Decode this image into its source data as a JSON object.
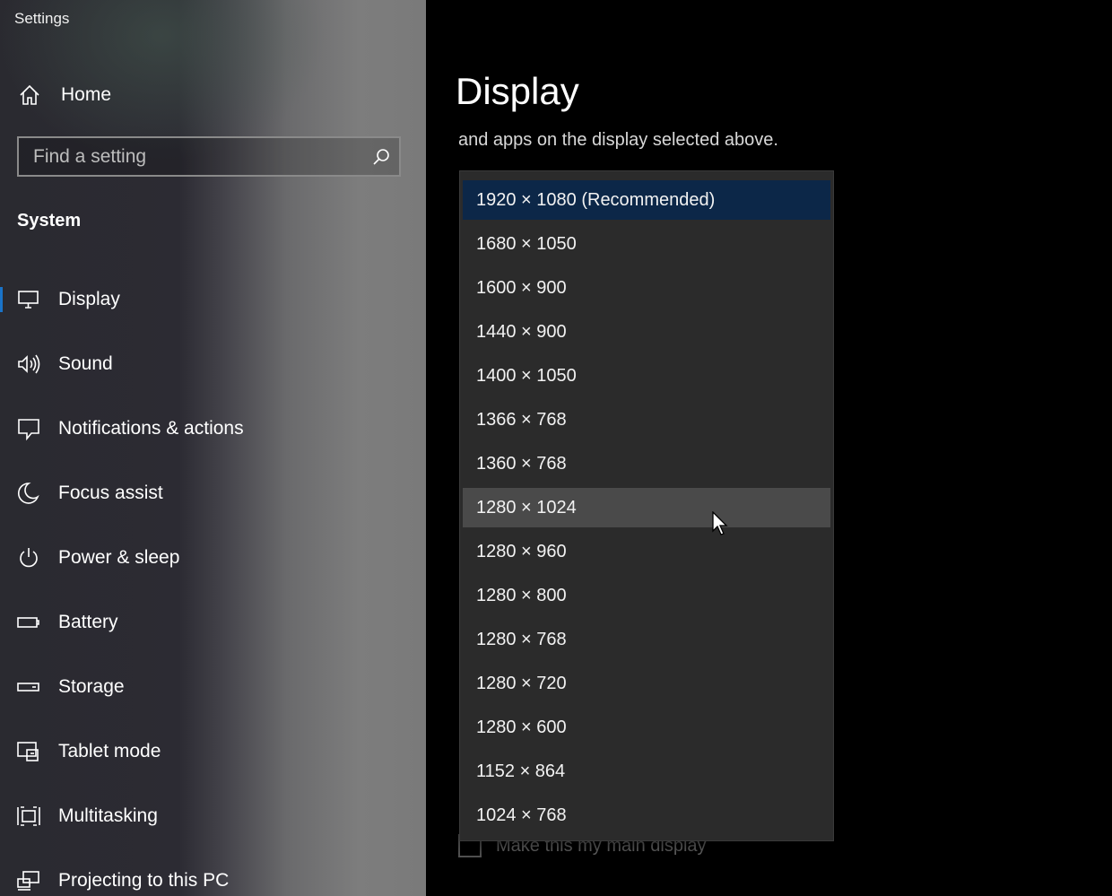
{
  "window": {
    "title": "Settings"
  },
  "sidebar": {
    "home_label": "Home",
    "search_placeholder": "Find a setting",
    "section_title": "System",
    "items": [
      {
        "label": "Display",
        "icon": "monitor-icon",
        "selected": true
      },
      {
        "label": "Sound",
        "icon": "speaker-icon"
      },
      {
        "label": "Notifications & actions",
        "icon": "notification-icon"
      },
      {
        "label": "Focus assist",
        "icon": "moon-icon"
      },
      {
        "label": "Power & sleep",
        "icon": "power-icon"
      },
      {
        "label": "Battery",
        "icon": "battery-icon"
      },
      {
        "label": "Storage",
        "icon": "storage-icon"
      },
      {
        "label": "Tablet mode",
        "icon": "tablet-mode-icon"
      },
      {
        "label": "Multitasking",
        "icon": "multitasking-icon"
      },
      {
        "label": "Projecting to this PC",
        "icon": "projecting-icon"
      }
    ]
  },
  "main": {
    "title": "Display",
    "description": "and apps on the display selected above.",
    "checkbox_label": "Make this my main display"
  },
  "resolution_dropdown": {
    "selected": "1920 × 1080 (Recommended)",
    "hovered": "1280 × 1024",
    "options": [
      "1920 × 1080 (Recommended)",
      "1680 × 1050",
      "1600 × 900",
      "1440 × 900",
      "1400 × 1050",
      "1366 × 768",
      "1360 × 768",
      "1280 × 1024",
      "1280 × 960",
      "1280 × 800",
      "1280 × 768",
      "1280 × 720",
      "1280 × 600",
      "1152 × 864",
      "1024 × 768"
    ]
  },
  "colors": {
    "accent": "#1a73c8",
    "selected_option_bg": "#0c2748",
    "hover_option_bg": "#4a4a4a",
    "link": "#3a8ee6"
  }
}
